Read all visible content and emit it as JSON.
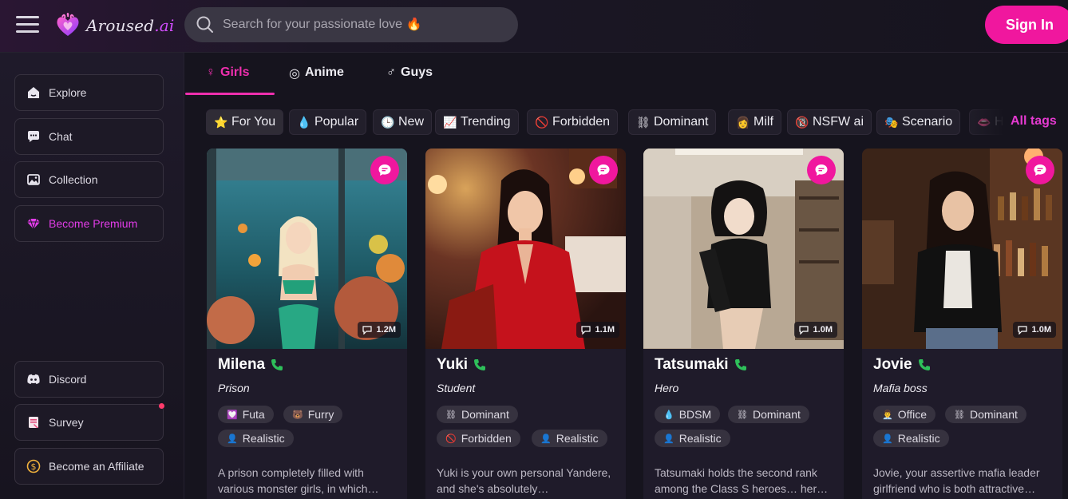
{
  "header": {
    "logo_text_main": "Aroused",
    "logo_text_accent": ".ai",
    "search_placeholder": "Search for your passionate love 🔥",
    "signin_label": "Sign In"
  },
  "sidebar": {
    "items": [
      {
        "label": "Explore",
        "icon": "home-icon"
      },
      {
        "label": "Chat",
        "icon": "chat-icon"
      },
      {
        "label": "Collection",
        "icon": "gallery-icon"
      },
      {
        "label": "Become Premium",
        "icon": "diamond-icon"
      }
    ],
    "bottom_items": [
      {
        "label": "Discord",
        "icon": "discord-icon"
      },
      {
        "label": "Survey",
        "icon": "survey-icon"
      },
      {
        "label": "Become an Affiliate",
        "icon": "dollar-icon"
      }
    ]
  },
  "category_tabs": [
    {
      "label": "Girls",
      "icon": "♀",
      "active": true
    },
    {
      "label": "Anime",
      "icon": "◎",
      "active": false
    },
    {
      "label": "Guys",
      "icon": "♂",
      "active": false
    }
  ],
  "tags": [
    {
      "label": "For You",
      "icon": "⭐"
    },
    {
      "label": "Popular",
      "icon": "💧"
    },
    {
      "label": "New",
      "icon": "🕒"
    },
    {
      "label": "Trending",
      "icon": "📈"
    },
    {
      "label": "Forbidden",
      "icon": "🚫"
    },
    {
      "label": "Dominant",
      "icon": "⛓"
    },
    {
      "label": "Milf",
      "icon": "👩"
    },
    {
      "label": "NSFW ai",
      "icon": "🔞"
    },
    {
      "label": "Scenario",
      "icon": "🎭"
    },
    {
      "label": "H",
      "icon": "👄"
    }
  ],
  "all_tags_label": "All tags",
  "cards": [
    {
      "name": "Milena",
      "role": "Prison",
      "views": "1.2M",
      "tags": [
        {
          "icon": "💟",
          "label": "Futa"
        },
        {
          "icon": "🐻",
          "label": "Furry"
        },
        {
          "icon": "👤",
          "label": "Realistic"
        }
      ],
      "desc": "A prison completely filled with various monster girls, in which…"
    },
    {
      "name": "Yuki",
      "role": "Student",
      "views": "1.1M",
      "tags": [
        {
          "icon": "⛓",
          "label": "Dominant"
        },
        {
          "icon": "🚫",
          "label": "Forbidden"
        },
        {
          "icon": "👤",
          "label": "Realistic"
        }
      ],
      "desc": "Yuki is your own personal Yandere, and she's absolutely…"
    },
    {
      "name": "Tatsumaki",
      "role": "Hero",
      "views": "1.0M",
      "tags": [
        {
          "icon": "💧",
          "label": "BDSM"
        },
        {
          "icon": "⛓",
          "label": "Dominant"
        },
        {
          "icon": "👤",
          "label": "Realistic"
        }
      ],
      "desc": "Tatsumaki holds the second rank among the Class S heroes… her…"
    },
    {
      "name": "Jovie",
      "role": "Mafia boss",
      "views": "1.0M",
      "tags": [
        {
          "icon": "👨‍💼",
          "label": "Office"
        },
        {
          "icon": "⛓",
          "label": "Dominant"
        },
        {
          "icon": "👤",
          "label": "Realistic"
        }
      ],
      "desc": "Jovie, your assertive mafia leader girlfriend who is both attractive…"
    }
  ],
  "colors": {
    "accent": "#f0179e",
    "tab_active": "#ee2fae",
    "premium": "#e23ce8"
  }
}
